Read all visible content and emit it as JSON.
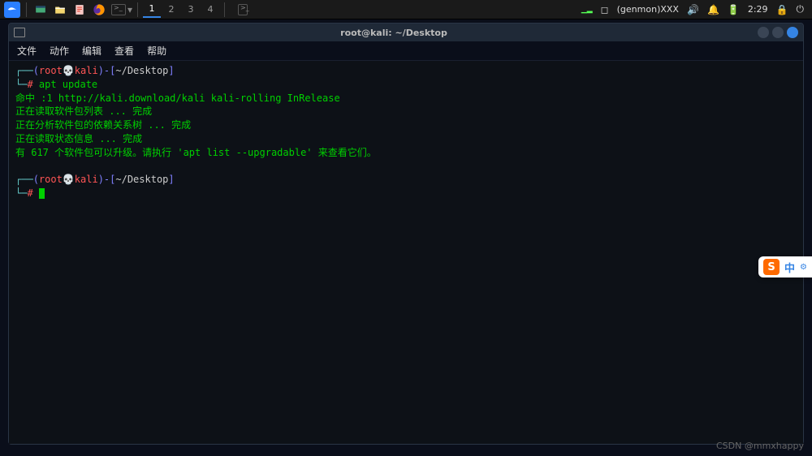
{
  "panel": {
    "workspaces": [
      "1",
      "2",
      "3",
      "4"
    ],
    "active_workspace": 0,
    "genmon": "(genmon)XXX",
    "time": "2:29"
  },
  "window": {
    "title": "root@kali: ~/Desktop",
    "menus": [
      "文件",
      "动作",
      "编辑",
      "查看",
      "帮助"
    ]
  },
  "terminal": {
    "prompt1": {
      "paren_open": "(",
      "user": "root",
      "skull": "💀",
      "host": "kali",
      "paren_close": ")-",
      "bracket_open": "[",
      "path": "~/Desktop",
      "bracket_close": "]",
      "hash": "#",
      "command": " apt update"
    },
    "output": [
      "命中 :1 http://kali.download/kali kali-rolling InRelease",
      "正在读取软件包列表 ... 完成",
      "正在分析软件包的依赖关系树 ... 完成",
      "正在读取状态信息 ... 完成",
      "有 617 个软件包可以升级。请执行 'apt list --upgradable' 来查看它们。"
    ],
    "prompt2": {
      "paren_open": "(",
      "user": "root",
      "skull": "💀",
      "host": "kali",
      "paren_close": ")-",
      "bracket_open": "[",
      "path": "~/Desktop",
      "bracket_close": "]",
      "hash": "#"
    }
  },
  "ime": {
    "letter": "S",
    "lang": "中"
  },
  "watermark": "CSDN @mmxhappy"
}
